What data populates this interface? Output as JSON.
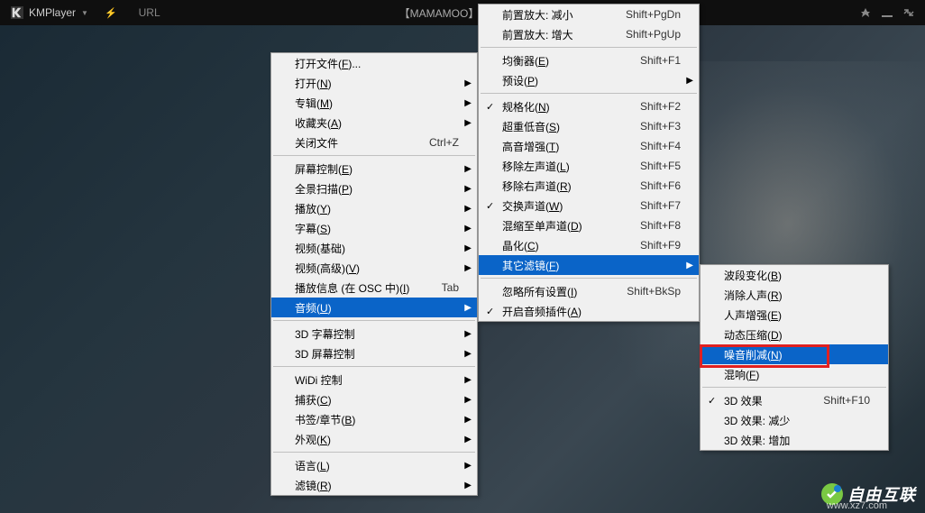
{
  "titlebar": {
    "app": "KMPlayer",
    "url_label": "URL",
    "title": "【MAMAMOO】MV- Wind"
  },
  "watermark": {
    "text": "自由互联",
    "url": "www.xz7.com"
  },
  "menu1": {
    "items": [
      {
        "label": "打开文件(F)...",
        "type": "item"
      },
      {
        "label": "打开(N)",
        "type": "sub"
      },
      {
        "label": "专辑(M)",
        "type": "sub"
      },
      {
        "label": "收藏夹(A)",
        "type": "sub"
      },
      {
        "label": "关闭文件",
        "shortcut": "Ctrl+Z",
        "type": "item"
      },
      {
        "type": "sep"
      },
      {
        "label": "屏幕控制(E)",
        "type": "sub"
      },
      {
        "label": "全景扫描(P)",
        "type": "sub"
      },
      {
        "label": "播放(Y)",
        "type": "sub"
      },
      {
        "label": "字幕(S)",
        "type": "sub"
      },
      {
        "label": "视频(基础)",
        "type": "sub"
      },
      {
        "label": "视频(高级)(V)",
        "type": "sub"
      },
      {
        "label": "播放信息 (在 OSC 中)(I)",
        "shortcut": "Tab",
        "type": "item"
      },
      {
        "label": "音频(U)",
        "type": "sub",
        "highlighted": true
      },
      {
        "type": "sep"
      },
      {
        "label": "3D 字幕控制",
        "type": "sub"
      },
      {
        "label": "3D 屏幕控制",
        "type": "sub"
      },
      {
        "type": "sep"
      },
      {
        "label": "WiDi 控制",
        "type": "sub"
      },
      {
        "label": "捕获(C)",
        "type": "sub"
      },
      {
        "label": "书签/章节(B)",
        "type": "sub"
      },
      {
        "label": "外观(K)",
        "type": "sub"
      },
      {
        "type": "sep"
      },
      {
        "label": "语言(L)",
        "type": "sub"
      },
      {
        "label": "滤镜(R)",
        "type": "sub"
      }
    ]
  },
  "menu2": {
    "items": [
      {
        "label": "前置放大: 减小",
        "shortcut": "Shift+PgDn",
        "type": "item"
      },
      {
        "label": "前置放大: 增大",
        "shortcut": "Shift+PgUp",
        "type": "item"
      },
      {
        "type": "sep"
      },
      {
        "label": "均衡器(E)",
        "shortcut": "Shift+F1",
        "type": "item"
      },
      {
        "label": "预设(P)",
        "type": "sub"
      },
      {
        "type": "sep"
      },
      {
        "label": "规格化(N)",
        "shortcut": "Shift+F2",
        "type": "item",
        "checked": true
      },
      {
        "label": "超重低音(S)",
        "shortcut": "Shift+F3",
        "type": "item"
      },
      {
        "label": "高音增强(T)",
        "shortcut": "Shift+F4",
        "type": "item"
      },
      {
        "label": "移除左声道(L)",
        "shortcut": "Shift+F5",
        "type": "item"
      },
      {
        "label": "移除右声道(R)",
        "shortcut": "Shift+F6",
        "type": "item"
      },
      {
        "label": "交换声道(W)",
        "shortcut": "Shift+F7",
        "type": "item",
        "checked": true
      },
      {
        "label": "混缩至单声道(D)",
        "shortcut": "Shift+F8",
        "type": "item"
      },
      {
        "label": "晶化(C)",
        "shortcut": "Shift+F9",
        "type": "item"
      },
      {
        "label": "其它滤镜(F)",
        "type": "sub",
        "highlighted": true
      },
      {
        "type": "sep"
      },
      {
        "label": "忽略所有设置(I)",
        "shortcut": "Shift+BkSp",
        "type": "item"
      },
      {
        "label": "开启音频插件(A)",
        "type": "item",
        "checked": true
      }
    ]
  },
  "menu3": {
    "items": [
      {
        "label": "波段变化(B)",
        "type": "item"
      },
      {
        "label": "消除人声(R)",
        "type": "item"
      },
      {
        "label": "人声增强(E)",
        "type": "item"
      },
      {
        "label": "动态压缩(D)",
        "type": "item"
      },
      {
        "label": "噪音削减(N)",
        "type": "item",
        "highlighted": true
      },
      {
        "label": "混响(F)",
        "type": "item"
      },
      {
        "type": "sep"
      },
      {
        "label": "3D 效果",
        "shortcut": "Shift+F10",
        "type": "item",
        "checked": true
      },
      {
        "label": "3D 效果: 减少",
        "type": "item"
      },
      {
        "label": "3D 效果: 增加",
        "type": "item"
      }
    ]
  }
}
